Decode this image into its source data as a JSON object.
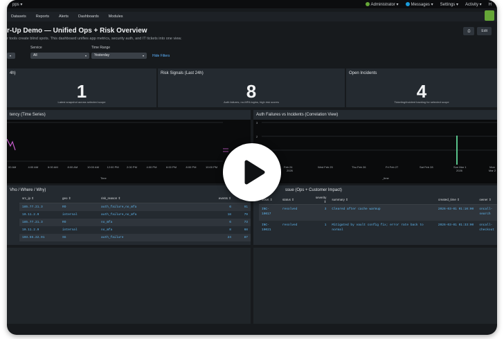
{
  "topbar": {
    "apps_label": "pps ▾",
    "administrator": "Administrator ▾",
    "messages": "Messages ▾",
    "settings": "Settings ▾",
    "activity": "Activity ▾",
    "help": "H"
  },
  "nav": {
    "items": [
      "Datasets",
      "Reports",
      "Alerts",
      "Dashboards",
      "Modules"
    ]
  },
  "dashboard": {
    "title": "r-Up Demo — Unified Ops + Risk Overview",
    "subtitle": "r tools create blind spots. This dashboard unifies app metrics, security auth, and IT tickets into one view.",
    "edit_label": "Edit"
  },
  "inputs": {
    "service_label": "Service",
    "service_value": "All",
    "time_range_label": "Time Range",
    "time_range_value": "Yesterday",
    "hide_filters": "Hide Filters"
  },
  "panels": {
    "p1_title": "4h)",
    "p1_value": "1",
    "p1_caption": "Latest snapshot across selected scope",
    "p2_title": "Risk Signals (Last 24h)",
    "p2_value": "8",
    "p2_caption": "Auth failures, no-MFA logins, high risk scores",
    "p3_title": "Open Incidents",
    "p3_value": "4",
    "p3_caption": "Ticketing/incident backlog for selected scope"
  },
  "latency_chart": {
    "title": "tency (Time Series)",
    "xlabel": "Time",
    "ticks": [
      "00 AM",
      "4:00 AM",
      "6:00 AM",
      "8:00 AM",
      "10:00 AM",
      "12:00 PM",
      "2:00 PM",
      "4:00 PM",
      "6:00 PM",
      "8:00 PM",
      "10:00 PM"
    ]
  },
  "auth_chart": {
    "title": "Auth Failures vs Incidents (Correlation View)",
    "xlabel": "_time",
    "y_ticks": [
      "3",
      "2",
      "1"
    ],
    "ticks": [
      "Feb 24",
      "Wed Feb 25",
      "Thu Feb 26",
      "Fri Feb 27",
      "Sat Feb 28",
      "Sun Mar 1",
      "Mon Mar 2"
    ],
    "tick_sub": "2026",
    "bar_color": "#59c28a"
  },
  "who_table": {
    "title": "Vho / Where / Why)",
    "headers": [
      "src_ip ⇕",
      "geo ⇕",
      "risk_reason ⇕",
      "events ⇕",
      "max_r"
    ],
    "rows": [
      [
        "185.77.21.3",
        "RO",
        "auth_failure,no_mfa",
        "6",
        "91"
      ],
      [
        "10.11.2.9",
        "internal",
        "auth_failure,no_mfa",
        "18",
        "79"
      ],
      [
        "185.77.21.3",
        "RO",
        "no_mfa",
        "6",
        "73"
      ],
      [
        "10.11.2.9",
        "internal",
        "no_mfa",
        "8",
        "68"
      ],
      [
        "103.55.22.91",
        "SG",
        "auth_failure",
        "24",
        "87"
      ]
    ]
  },
  "incident_table": {
    "title": "ssue (Ops + Customer Impact)",
    "headers": [
      "ticket ⇕",
      "status ⇕",
      "severity ⇕",
      "summary ⇕",
      "created_time ⇕",
      "owner ⇕"
    ],
    "rows": [
      [
        "INC-10017",
        "resolved",
        "3",
        "Cleared after cache warmup",
        "2026-03-01 01:10:00",
        "oncall-search"
      ],
      [
        "INC-10021",
        "resolved",
        "1",
        "Mitigated by vault config fix; error rate back to normal",
        "2026-03-01 01:33:00",
        "oncall-checkout"
      ]
    ]
  },
  "colors": {
    "accent_link": "#5fb7f0",
    "status_ok": "#65a637",
    "messages_badge": "#1a9bdb"
  }
}
